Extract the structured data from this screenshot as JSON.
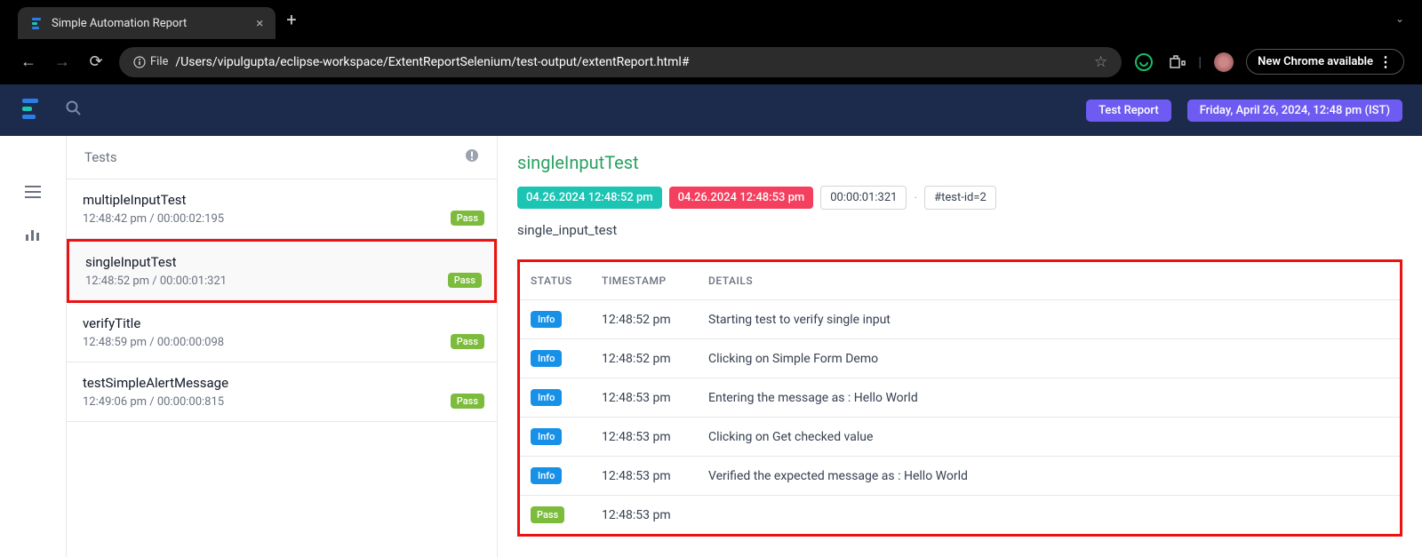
{
  "browser": {
    "tab_title": "Simple Automation Report",
    "file_label": "File",
    "url": "/Users/vipulgupta/eclipse-workspace/ExtentReportSelenium/test-output/extentReport.html#",
    "new_chrome_label": "New Chrome available"
  },
  "topbar": {
    "report_label": "Test Report",
    "datetime_label": "Friday, April 26, 2024, 12:48 pm (IST)"
  },
  "tests_panel": {
    "header": "Tests",
    "items": [
      {
        "name": "multipleInputTest",
        "time": "12:48:42 pm / 00:00:02:195",
        "status": "Pass"
      },
      {
        "name": "singleInputTest",
        "time": "12:48:52 pm / 00:00:01:321",
        "status": "Pass"
      },
      {
        "name": "verifyTitle",
        "time": "12:48:59 pm / 00:00:00:098",
        "status": "Pass"
      },
      {
        "name": "testSimpleAlertMessage",
        "time": "12:49:06 pm / 00:00:00:815",
        "status": "Pass"
      }
    ]
  },
  "detail": {
    "title": "singleInputTest",
    "start": "04.26.2024 12:48:52 pm",
    "end": "04.26.2024 12:48:53 pm",
    "duration": "00:00:01:321",
    "tag": "#test-id=2",
    "desc": "single_input_test",
    "columns": {
      "status": "STATUS",
      "timestamp": "TIMESTAMP",
      "details": "DETAILS"
    },
    "steps": [
      {
        "status": "Info",
        "time": "12:48:52 pm",
        "details": "Starting test to verify single input"
      },
      {
        "status": "Info",
        "time": "12:48:52 pm",
        "details": "Clicking on Simple Form Demo"
      },
      {
        "status": "Info",
        "time": "12:48:53 pm",
        "details": "Entering the message as : Hello World"
      },
      {
        "status": "Info",
        "time": "12:48:53 pm",
        "details": "Clicking on Get checked value"
      },
      {
        "status": "Info",
        "time": "12:48:53 pm",
        "details": "Verified the expected message as : Hello World"
      },
      {
        "status": "Pass",
        "time": "12:48:53 pm",
        "details": ""
      }
    ]
  }
}
